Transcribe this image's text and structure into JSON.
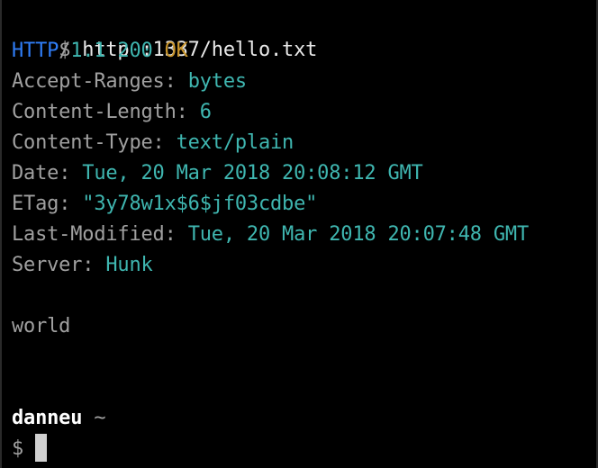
{
  "command": {
    "prompt_symbol": "$",
    "text": "http :1337/hello.txt"
  },
  "status": {
    "protocol": "HTTP",
    "separator": "/",
    "version": "1.1",
    "code": "200",
    "reason": "OK"
  },
  "headers": [
    {
      "name": "Accept-Ranges",
      "value": "bytes"
    },
    {
      "name": "Content-Length",
      "value": "6"
    },
    {
      "name": "Content-Type",
      "value": "text/plain"
    },
    {
      "name": "Date",
      "value": "Tue, 20 Mar 2018 20:08:12 GMT"
    },
    {
      "name": "ETag",
      "value": "\"3y78w1x$6$jf03cdbe\""
    },
    {
      "name": "Last-Modified",
      "value": "Tue, 20 Mar 2018 20:07:48 GMT"
    },
    {
      "name": "Server",
      "value": "Hunk"
    }
  ],
  "header_separator": ": ",
  "body_text": "world",
  "next_prompt": {
    "user": "danneu",
    "path": "~",
    "prompt_symbol": "$"
  },
  "colors": {
    "background": "#000000",
    "gray": "#a0a0a0",
    "cyan": "#3fb6b0",
    "blue": "#2f7df6",
    "orange": "#c9952b"
  }
}
